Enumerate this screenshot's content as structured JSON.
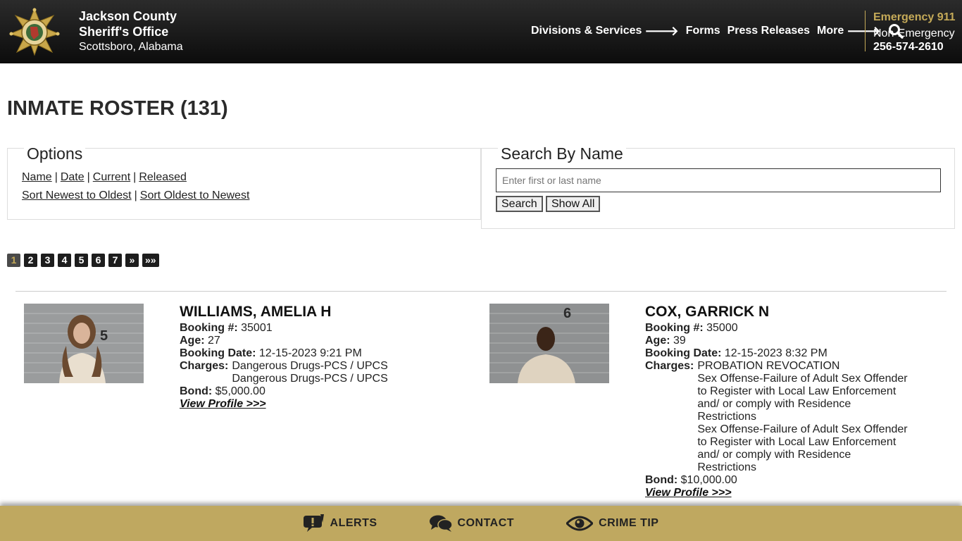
{
  "header": {
    "org_line1": "Jackson County",
    "org_line2": "Sheriff's Office",
    "org_line3": "Scottsboro, Alabama",
    "nav": [
      {
        "label": "Divisions & Services",
        "arrow": true
      },
      {
        "label": "Forms",
        "arrow": false
      },
      {
        "label": "Press Releases",
        "arrow": false
      },
      {
        "label": "More",
        "arrow": true
      }
    ],
    "arrow_glyph": "🡒",
    "emergency_label": "Emergency 911",
    "nonemergency_label": "Non-Emergency",
    "nonemergency_phone": "256-574-2610",
    "accent_color": "#c5aa58"
  },
  "page": {
    "title": "INMATE ROSTER (131)"
  },
  "options": {
    "legend": "Options",
    "filters": [
      "Name",
      "Date",
      "Current",
      "Released"
    ],
    "sorts": [
      "Sort Newest to Oldest",
      "Sort Oldest to Newest"
    ],
    "separator": "|"
  },
  "search": {
    "legend": "Search By Name",
    "placeholder": "Enter first or last name",
    "search_label": "Search",
    "show_all_label": "Show All"
  },
  "pagination": {
    "pages": [
      "1",
      "2",
      "3",
      "4",
      "5",
      "6",
      "7",
      "»",
      "»»"
    ],
    "active": "1"
  },
  "labels": {
    "booking": "Booking #:",
    "age": "Age:",
    "booking_date": "Booking Date:",
    "charges": "Charges:",
    "bond": "Bond:",
    "view_profile": "View Profile >>>"
  },
  "inmates": [
    {
      "name": "WILLIAMS, AMELIA H",
      "booking": "35001",
      "age": "27",
      "booking_date": "12-15-2023 9:21 PM",
      "charges": [
        "Dangerous Drugs-PCS / UPCS",
        "Dangerous Drugs-PCS / UPCS"
      ],
      "bond": "$5,000.00",
      "placard_number": "5"
    },
    {
      "name": "COX, GARRICK N",
      "booking": "35000",
      "age": "39",
      "booking_date": "12-15-2023 8:32 PM",
      "charges": [
        "PROBATION REVOCATION",
        "Sex Offense-Failure of Adult Sex Offender to Register with Local Law Enforcement and/ or comply with Residence Restrictions",
        "Sex Offense-Failure of Adult Sex Offender to Register with Local Law Enforcement and/ or comply with Residence Restrictions"
      ],
      "bond": "$10,000.00",
      "placard_number": "6"
    }
  ],
  "footer": {
    "alerts": "ALERTS",
    "contact": "CONTACT",
    "crime_tip": "CRIME TIP"
  }
}
